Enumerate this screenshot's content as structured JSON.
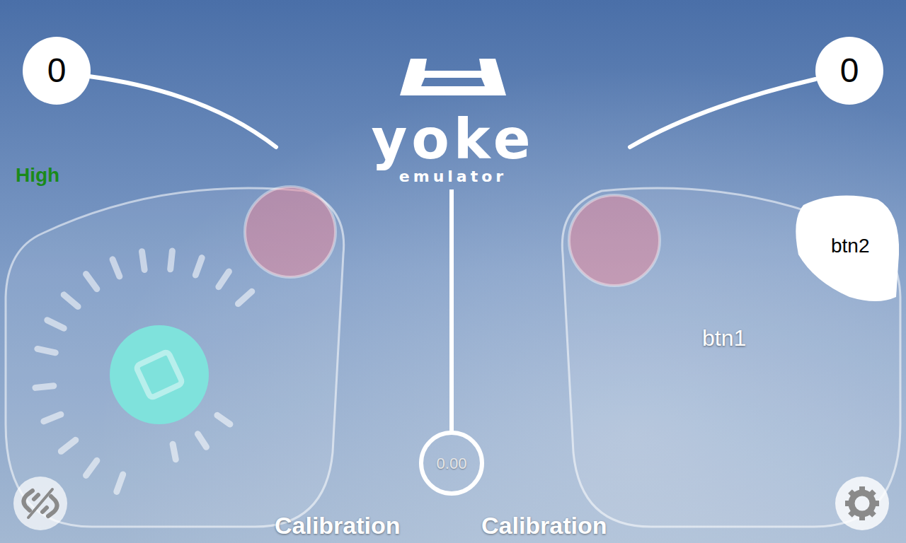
{
  "logo": {
    "title": "yoke",
    "subtitle": "emulator"
  },
  "counters": [
    {
      "value": "0"
    },
    {
      "value": "0"
    }
  ],
  "sensitivity": "High",
  "center": {
    "reading": "0.00"
  },
  "calibration": [
    {
      "label": "Calibration"
    },
    {
      "label": "Calibration"
    }
  ],
  "buttons": [
    {
      "label": "btn2"
    },
    {
      "label": "btn1"
    }
  ]
}
